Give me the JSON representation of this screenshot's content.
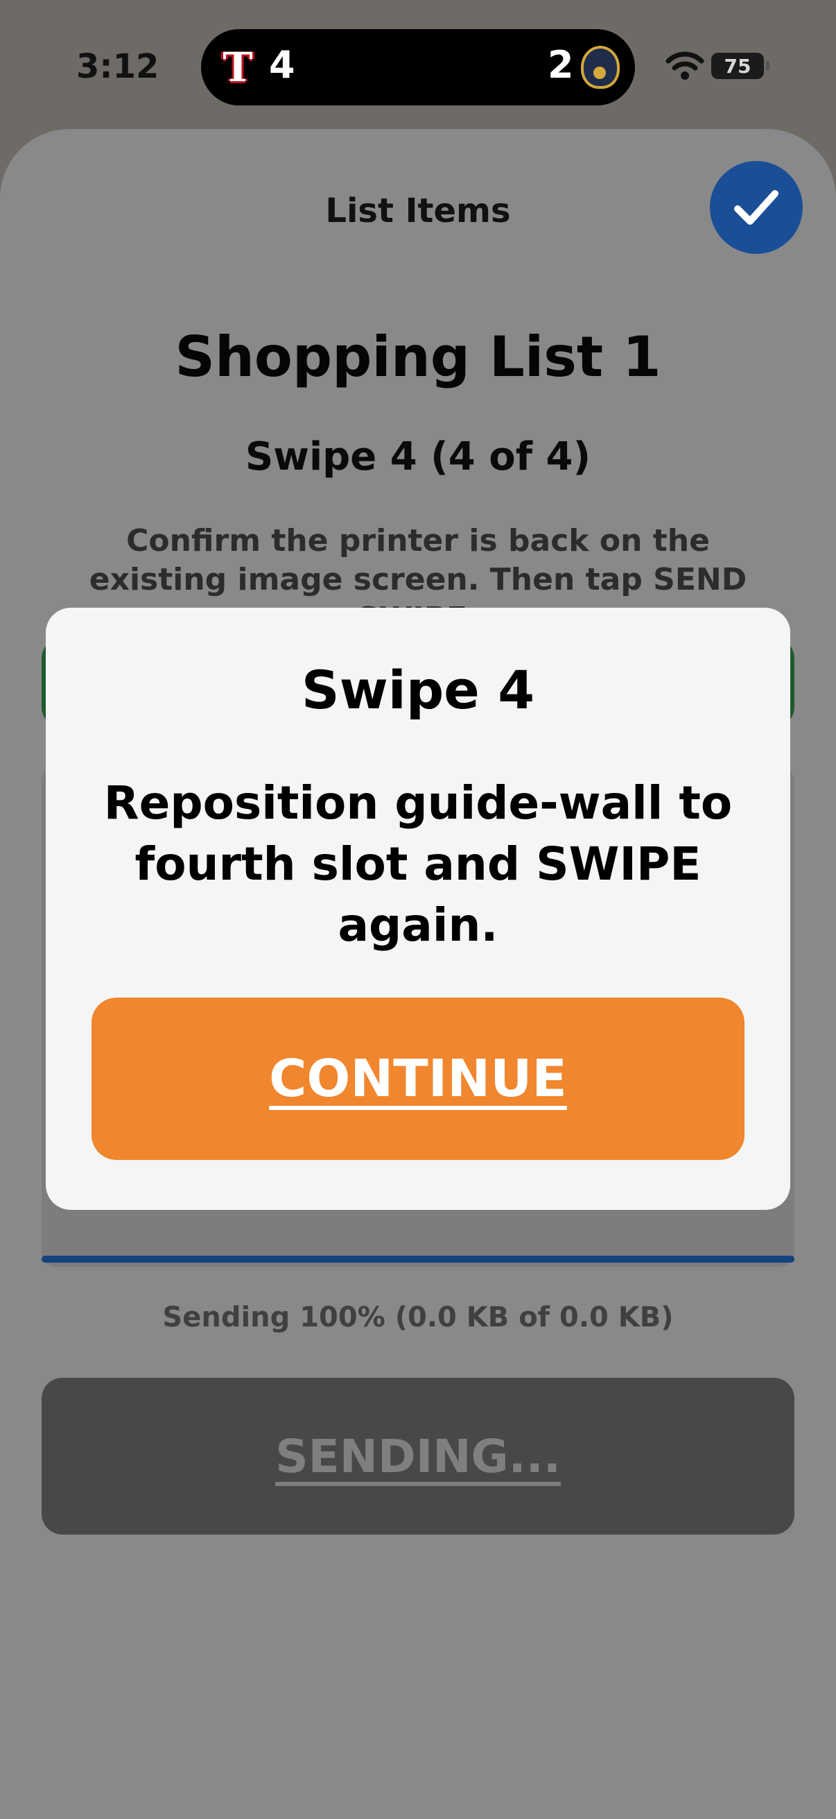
{
  "status_bar": {
    "time": "3:12",
    "live_activity": {
      "home_team_icon": "rangers-t-logo-icon",
      "home_score": "4",
      "away_score": "2",
      "away_team_icon": "brewers-glove-logo-icon"
    },
    "battery": "75"
  },
  "sheet": {
    "title": "List Items",
    "done_icon": "checkmark-icon"
  },
  "main": {
    "list_name": "Shopping List 1",
    "swipe_step": "Swipe 4 (4 of 4)",
    "instruction": "Confirm the printer is back on the existing image screen. Then tap SEND SWIPE.",
    "progress_fraction": 1.0,
    "sending_status": "Sending 100% (0.0 KB of 0.0 KB)",
    "sending_button": "SENDING..."
  },
  "modal": {
    "title": "Swipe 4",
    "message": "Reposition guide-wall to fourth slot and SWIPE again.",
    "continue_label": "CONTINUE"
  },
  "colors": {
    "accent_blue": "#1a4e96",
    "continue_orange": "#f0862d",
    "confirm_green": "#1f5a2e"
  }
}
